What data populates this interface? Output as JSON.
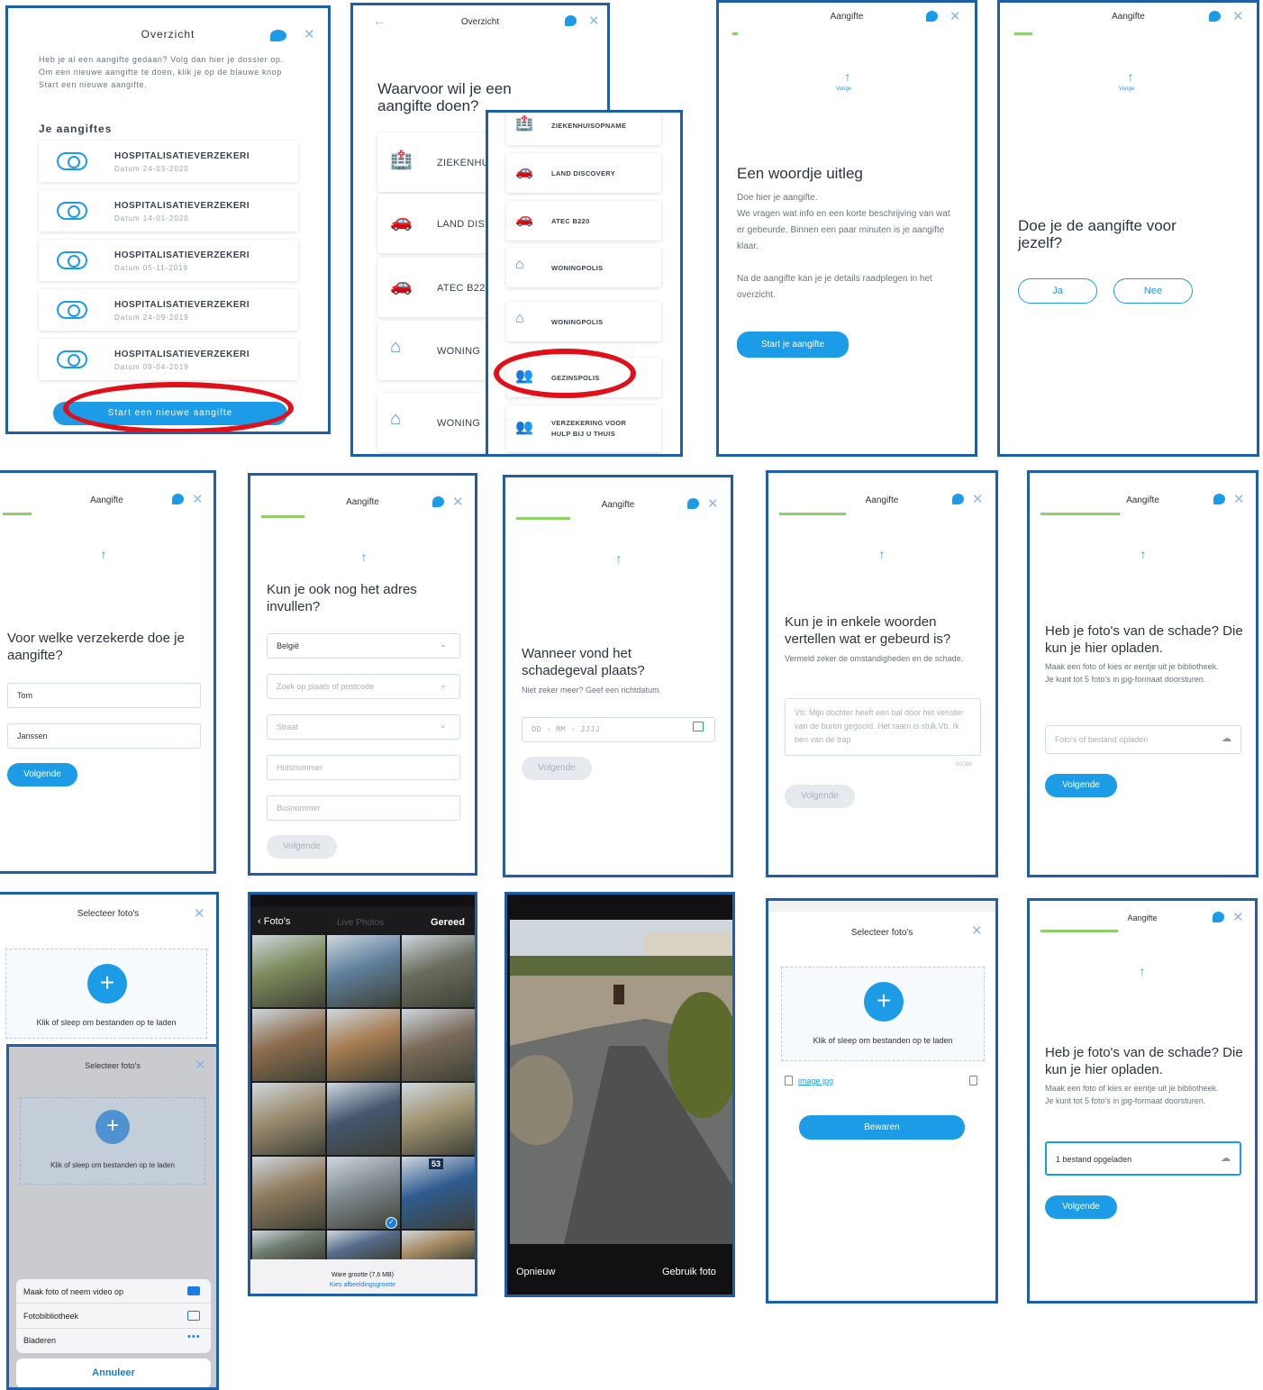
{
  "overview": {
    "title": "Overzicht",
    "intro": "Heb je al een aangifte gedaan? Volg dan hier je dossier op. Om een nieuwe aangifte te doen, klik je op de blauwe knop Start een nieuwe aangifte.",
    "section": "Je aangiftes",
    "items": [
      {
        "title": "HOSPITALISATIEVERZEKERI",
        "date": "Datum 24-03-2020"
      },
      {
        "title": "HOSPITALISATIEVERZEKERI",
        "date": "Datum 14-01-2020"
      },
      {
        "title": "HOSPITALISATIEVERZEKERI",
        "date": "Datum 05-11-2019"
      },
      {
        "title": "HOSPITALISATIEVERZEKERI",
        "date": "Datum 24-09-2019"
      },
      {
        "title": "HOSPITALISATIEVERZEKERI",
        "date": "Datum 09-04-2019"
      }
    ],
    "start_button": "Start een nieuwe aangifte"
  },
  "choose": {
    "title": "Overzicht",
    "question": "Waarvoor wil je een aangifte doen?",
    "items": [
      "ZIEKENHU",
      "LAND DIS",
      "ATEC B22",
      "WONING",
      "WONING"
    ],
    "zoom_items": [
      "ZIEKENHUISOPNAME",
      "LAND DISCOVERY",
      "ATEC B220",
      "WONINGPOLIS",
      "WONINGPOLIS",
      "GEZINSPOLIS",
      "VERZEKERING VOOR HULP BIJ U THUIS"
    ]
  },
  "explain": {
    "title": "Aangifte",
    "prev": "Vorige",
    "heading": "Een woordje uitleg",
    "p1": "Doe hier je aangifte.",
    "p2": "We vragen wat info en een korte beschrijving van wat er gebeurde. Binnen een paar minuten is je aangifte klaar.",
    "p3": "Na de aangifte kan je je details raadplegen in het overzicht.",
    "button": "Start je aangifte"
  },
  "self": {
    "title": "Aangifte",
    "prev": "Vorige",
    "question": "Doe je de aangifte voor jezelf?",
    "yes": "Ja",
    "no": "Nee"
  },
  "insured": {
    "title": "Aangifte",
    "question": "Voor welke verzekerde doe je aangifte?",
    "first": "Tom",
    "last": "Janssen",
    "button": "Volgende"
  },
  "address": {
    "title": "Aangifte",
    "question": "Kun je ook nog het adres invullen?",
    "country": "België",
    "place": "Zoek op plaats of postcode",
    "street": "Straat",
    "number": "Huisnummer",
    "box": "Busnummer",
    "button": "Volgende"
  },
  "date": {
    "title": "Aangifte",
    "question": "Wanneer vond het schadegeval plaats?",
    "hint": "Niet zeker meer? Geef een richtdatum.",
    "placeholder": "DD - MM - JJJJ",
    "button": "Volgende"
  },
  "describe": {
    "title": "Aangifte",
    "question": "Kun je in enkele woorden vertellen wat er gebeurd is?",
    "hint": "Vermeld zeker de omstandigheden en de schade.",
    "placeholder": "Vb: Mijn dochter heeft een bal door het venster van de buren gegooid. Het raam is stuk.Vb. Ik ben van de trap",
    "counter": "0/1000",
    "button": "Volgende"
  },
  "photos": {
    "title": "Aangifte",
    "question": "Heb je foto's van de schade? Die kun je hier opladen.",
    "hint": "Maak een foto of kies er eentje uit je bibliotheek. Je kunt tot 5 foto's in jpg-formaat doorsturen.",
    "upload": "Foto's of bestand opladen",
    "button": "Volgende"
  },
  "select": {
    "title": "Selecteer foto's",
    "drop": "Klik of sleep om bestanden op te laden",
    "sheet": [
      "Maak foto of neem video op",
      "Fotobibliotheek",
      "Bladeren"
    ],
    "cancel": "Annuleer"
  },
  "library": {
    "back": "Foto's",
    "title": "Live Photos",
    "done": "Gereed",
    "size": "Ware grootte (7,6 MB)",
    "choose": "Kies afbeeldingsgrootte",
    "badge": "53"
  },
  "camera": {
    "retake": "Opnieuw",
    "use": "Gebruik foto"
  },
  "saved": {
    "title": "Selecteer foto's",
    "drop": "Klik of sleep om bestanden op te laden",
    "file": "image.jpg",
    "button": "Bewaren"
  },
  "done": {
    "title": "Aangifte",
    "question": "Heb je foto's van de schade? Die kun je hier opladen.",
    "hint": "Maak een foto of kies er eentje uit je bibliotheek. Je kunt tot 5 foto's in jpg-formaat doorsturen.",
    "uploaded": "1 bestand opgeladen",
    "button": "Volgende"
  }
}
